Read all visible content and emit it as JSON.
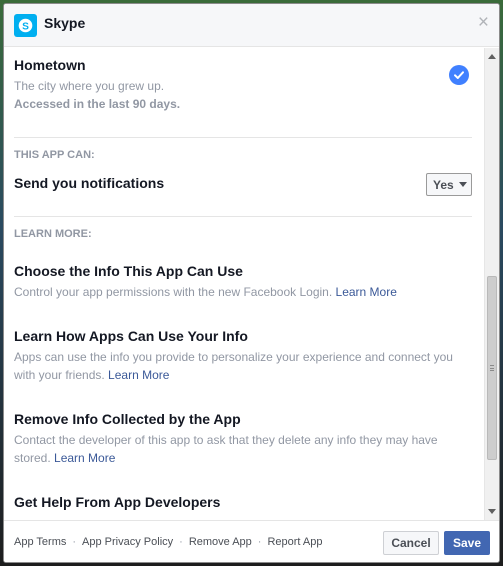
{
  "header": {
    "app_name": "Skype",
    "close_glyph": "×",
    "icon": "skype-logo-icon"
  },
  "permission": {
    "title": "Hometown",
    "description": "The city where you grew up.",
    "accessed": "Accessed in the last 90 days.",
    "icon": "check-circle-icon"
  },
  "this_app_can": {
    "label": "THIS APP CAN:",
    "notification_label": "Send you notifications",
    "notification_value": "Yes"
  },
  "learn_more": {
    "label": "LEARN MORE:",
    "items": [
      {
        "title": "Choose the Info This App Can Use",
        "desc": "Control your app permissions with the new Facebook Login. ",
        "link": "Learn More"
      },
      {
        "title": "Learn How Apps Can Use Your Info",
        "desc": "Apps can use the info you provide to personalize your experience and connect you with your friends. ",
        "link": "Learn More"
      },
      {
        "title": "Remove Info Collected by the App",
        "desc": "Contact the developer of this app to ask that they delete any info they may have stored. ",
        "link": "Learn More"
      },
      {
        "title": "Get Help From App Developers",
        "desc": "",
        "link": ""
      }
    ]
  },
  "footer": {
    "links": [
      "App Terms",
      "App Privacy Policy",
      "Remove App",
      "Report App"
    ],
    "separator": "·",
    "cancel_label": "Cancel",
    "save_label": "Save"
  },
  "colors": {
    "primary": "#4267b2",
    "link": "#3b5998",
    "check": "#4080ff",
    "skype": "#00aff0"
  }
}
